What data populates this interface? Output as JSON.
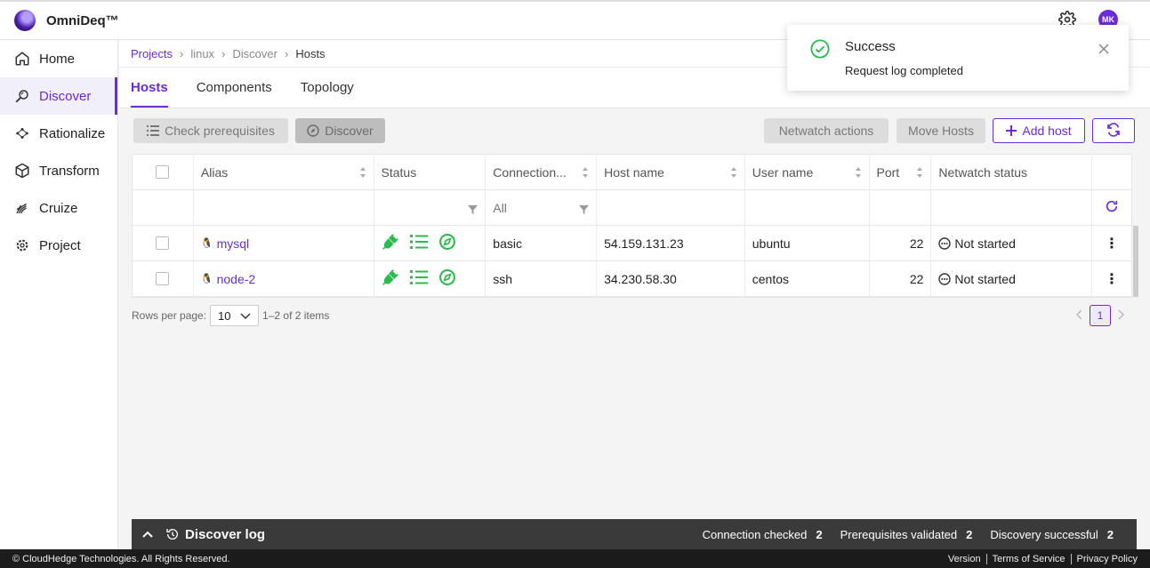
{
  "app": {
    "name": "OmniDeq™",
    "avatar_initials": "MK",
    "accent": "#6b2bd9"
  },
  "sidebar": {
    "items": [
      {
        "label": "Home",
        "icon": "home-icon"
      },
      {
        "label": "Discover",
        "icon": "discover-icon",
        "active": true
      },
      {
        "label": "Rationalize",
        "icon": "rationalize-icon"
      },
      {
        "label": "Transform",
        "icon": "cube-icon"
      },
      {
        "label": "Cruize",
        "icon": "cruize-icon"
      },
      {
        "label": "Project",
        "icon": "gear-icon"
      }
    ]
  },
  "breadcrumb": [
    "Projects",
    "linux",
    "Discover",
    "Hosts"
  ],
  "tabs": [
    "Hosts",
    "Components",
    "Topology"
  ],
  "toolbar": {
    "check_prereq": "Check prerequisites",
    "discover": "Discover",
    "netwatch_actions": "Netwatch actions",
    "move_hosts": "Move Hosts",
    "add_host": "Add host"
  },
  "table": {
    "columns": [
      "Alias",
      "Status",
      "Connection...",
      "Host name",
      "User name",
      "Port",
      "Netwatch status"
    ],
    "connection_filter": "All",
    "rows": [
      {
        "alias": "mysql",
        "connection": "basic",
        "host": "54.159.131.23",
        "user": "ubuntu",
        "port": "22",
        "netwatch": "Not started"
      },
      {
        "alias": "node-2",
        "connection": "ssh",
        "host": "34.230.58.30",
        "user": "centos",
        "port": "22",
        "netwatch": "Not started"
      }
    ]
  },
  "pagination": {
    "rows_per_page_label": "Rows per page:",
    "rows_per_page": "10",
    "count": "1–2 of 2 items",
    "page": "1"
  },
  "log": {
    "title": "Discover log",
    "stats": [
      {
        "label": "Connection checked",
        "value": "2"
      },
      {
        "label": "Prerequisites validated",
        "value": "2"
      },
      {
        "label": "Discovery successful",
        "value": "2"
      }
    ]
  },
  "footer": {
    "copyright": "© CloudHedge Technologies. All Rights Reserved.",
    "links": [
      "Version",
      "Terms of Service",
      "Privacy Policy"
    ]
  },
  "toast": {
    "title": "Success",
    "message": "Request log completed"
  }
}
